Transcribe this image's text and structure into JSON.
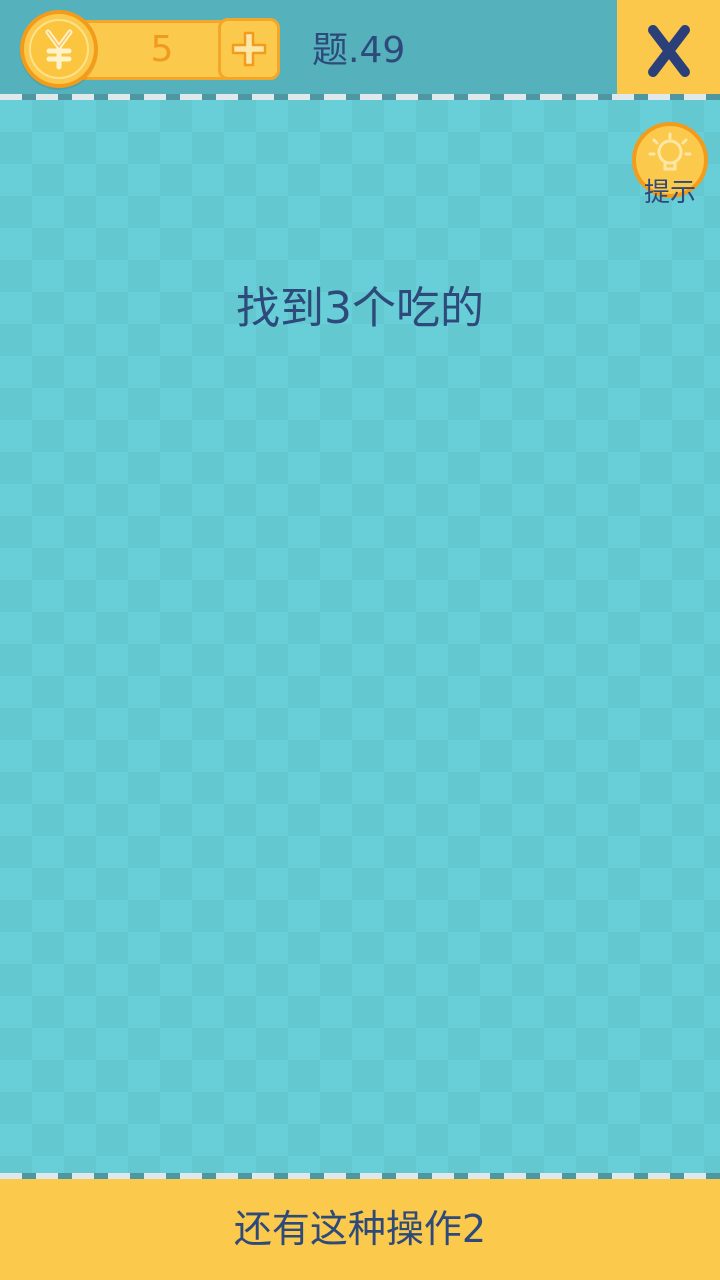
{
  "header": {
    "coins": "5",
    "currency_icon": "yuan-coin-icon",
    "add_icon": "plus-icon",
    "level_label": "题.49",
    "close_icon": "close-icon"
  },
  "hint": {
    "label": "提示",
    "icon": "lightbulb-icon"
  },
  "question": {
    "text": "找到3个吃的"
  },
  "footer": {
    "title": "还有这种操作2"
  },
  "colors": {
    "background": "#68cfd8",
    "topbar": "#55b1bb",
    "accent_yellow": "#fbc94b",
    "accent_orange": "#f39c1c",
    "text_navy": "#2d4a7a"
  }
}
